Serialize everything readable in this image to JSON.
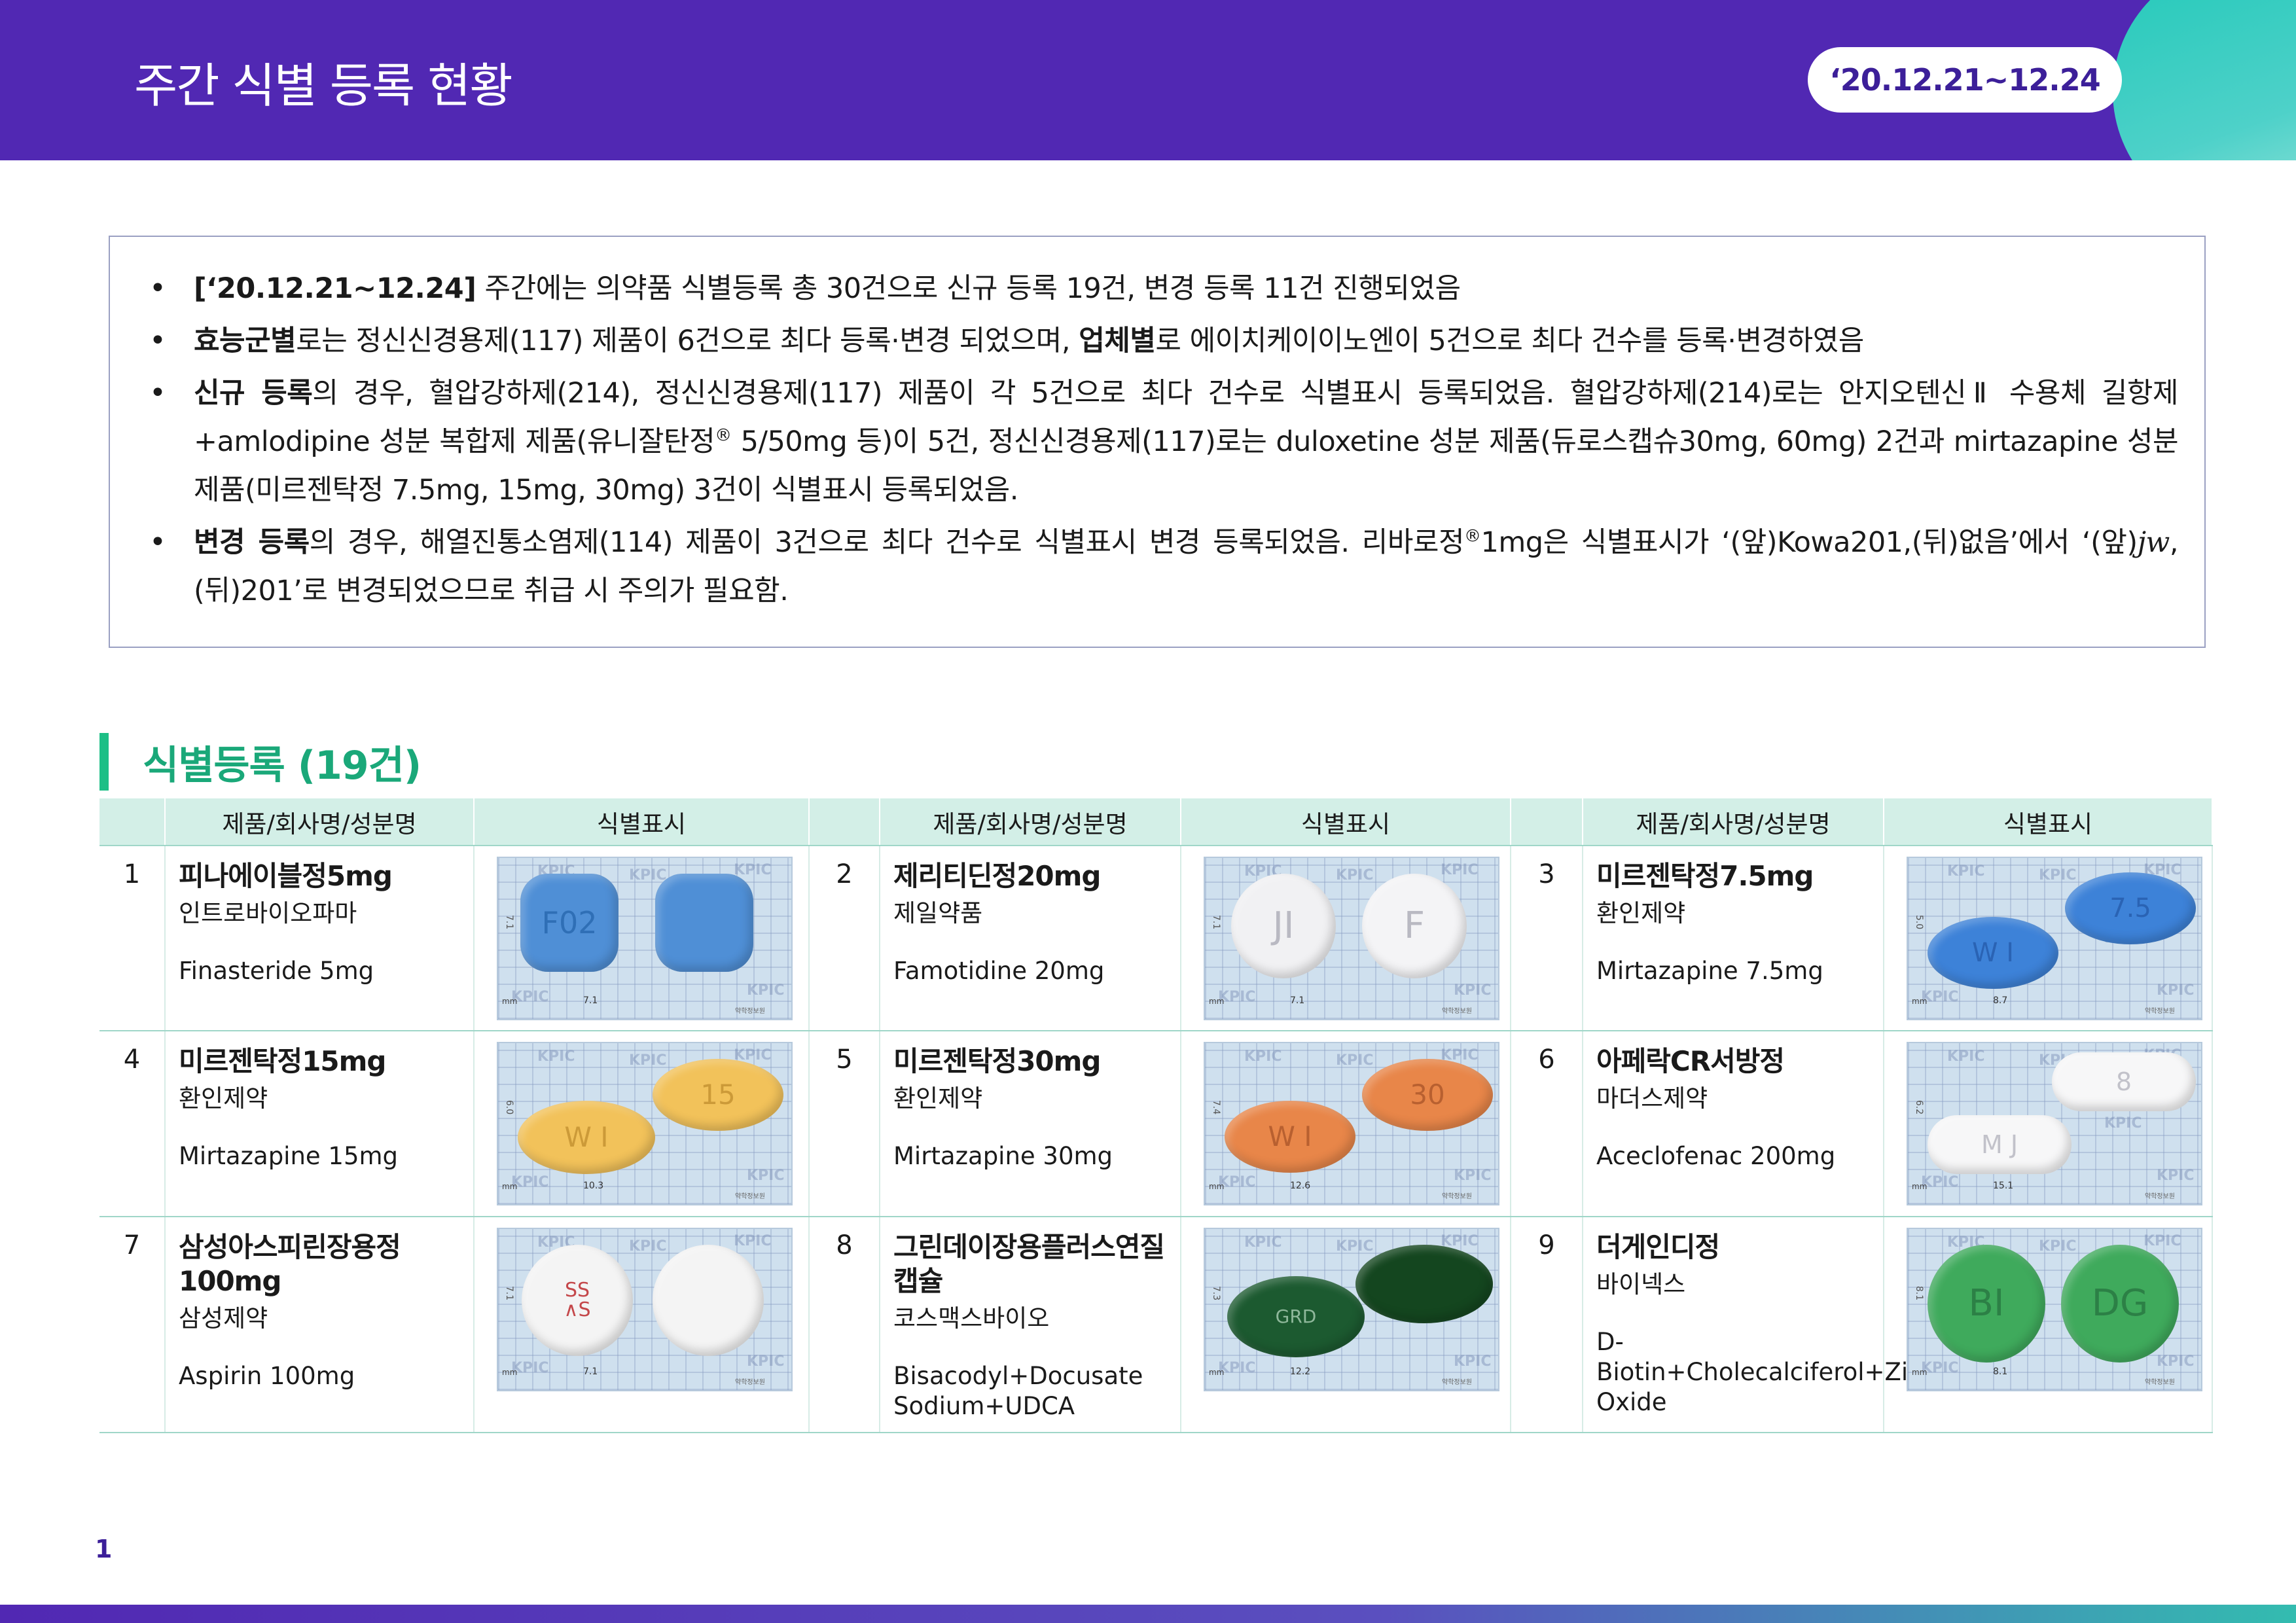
{
  "header": {
    "title": "주간 식별 등록 현황",
    "date_range": "‘20.12.21~12.24"
  },
  "summary": {
    "b1": {
      "bold": "[‘20.12.21~12.24]",
      "text": " 주간에는 의약품 식별등록 총 30건으로 신규 등록 19건, 변경 등록 11건 진행되었음"
    },
    "b2": {
      "bold1": "효능군별",
      "t1": "로는 정신신경용제(117) 제품이 6건으로 최다 등록·변경 되었으며, ",
      "bold2": "업체별",
      "t2": "로 에이치케이이노엔이 5건으로 최다 건수를 등록·변경하였음"
    },
    "b3": {
      "bold": "신규 등록",
      "t1": "의 경우, 혈압강하제(214), 정신신경용제(117) 제품이 각 5건으로 최다 건수로 식별표시 등록되었음. 혈압강하제(214)로는 안지오텐신Ⅱ 수용체 길항제+amlodipine 성분 복합제 제품(유니잘탄정",
      "sup": "®",
      "t2": " 5/50mg 등)이 5건, 정신신경용제(117)로는 duloxetine 성분 제품(듀로스캡슈30mg, 60mg) 2건과 mirtazapine 성분 제품(미르젠탁정 7.5mg, 15mg, 30mg) 3건이 식별표시 등록되었음."
    },
    "b4": {
      "bold": "변경 등록",
      "t1": "의 경우, 해열진통소염제(114) 제품이 3건으로 최다 건수로 식별표시 변경 등록되었음. 리바로정",
      "sup": "®",
      "t2": "1mg은 식별표시가 ‘(앞)Kowa201,(뒤)없음’에서 ‘(앞)",
      "italic": "jw",
      "t3": ",(뒤)201’로 변경되었으므로 취급 시 주의가 필요함."
    }
  },
  "section": {
    "title": "식별등록 (19건)"
  },
  "table": {
    "headers": [
      "제품/회사명/성분명",
      "식별표시"
    ],
    "items": [
      {
        "no": "1",
        "name": "피나에이블정5mg",
        "company": "인트로바이오파마",
        "ingredient": "Finasteride 5mg",
        "img": {
          "ruler_v": "7.1",
          "ruler_h": "7.1",
          "front": "F02",
          "back": ""
        }
      },
      {
        "no": "2",
        "name": "제리티딘정20mg",
        "company": "제일약품",
        "ingredient": "Famotidine 20mg",
        "img": {
          "ruler_v": "7.1",
          "ruler_h": "7.1",
          "front": "JI",
          "back": "F"
        }
      },
      {
        "no": "3",
        "name": "미르젠탁정7.5mg",
        "company": "환인제약",
        "ingredient": "Mirtazapine 7.5mg",
        "img": {
          "ruler_v": "5.0",
          "ruler_h": "8.7",
          "front": "W I",
          "back": "7.5"
        }
      },
      {
        "no": "4",
        "name": "미르젠탁정15mg",
        "company": "환인제약",
        "ingredient": "Mirtazapine 15mg",
        "img": {
          "ruler_v": "6.0",
          "ruler_h": "10.3",
          "front": "W I",
          "back": "15"
        }
      },
      {
        "no": "5",
        "name": "미르젠탁정30mg",
        "company": "환인제약",
        "ingredient": "Mirtazapine 30mg",
        "img": {
          "ruler_v": "7.4",
          "ruler_h": "12.6",
          "front": "W I",
          "back": "30"
        }
      },
      {
        "no": "6",
        "name": "아페락CR서방정",
        "company": "마더스제약",
        "ingredient": "Aceclofenac 200mg",
        "img": {
          "ruler_v": "6.2",
          "ruler_h": "15.1",
          "front": "M J",
          "back": "8"
        }
      },
      {
        "no": "7",
        "name": "삼성아스피린장용정 100mg",
        "company": "삼성제약",
        "ingredient": "Aspirin 100mg",
        "img": {
          "ruler_v": "7.1",
          "ruler_h": "7.1",
          "front": "SS\n∧S",
          "back": ""
        }
      },
      {
        "no": "8",
        "name": "그린데이장용플러스연질캡슐",
        "company": "코스맥스바이오",
        "ingredient": "Bisacodyl+Docusate Sodium+UDCA",
        "img": {
          "ruler_v": "7.3",
          "ruler_h": "12.2",
          "front": "GRD",
          "back": ""
        }
      },
      {
        "no": "9",
        "name": "더게인디정",
        "company": "바이넥스",
        "ingredient": "D-Biotin+Cholecalciferol+Zinc Oxide",
        "img": {
          "ruler_v": "8.1",
          "ruler_h": "8.1",
          "front": "BI",
          "back": "DG"
        }
      }
    ],
    "img_brand": "약학정보원",
    "img_unit": "mm",
    "watermark": "KPIC"
  },
  "footer": {
    "page_number": "1"
  },
  "colors": {
    "header": "#5128b3",
    "accent_green": "#1aa879",
    "table_header": "#d3efe7",
    "teal": "#23c9b9"
  }
}
